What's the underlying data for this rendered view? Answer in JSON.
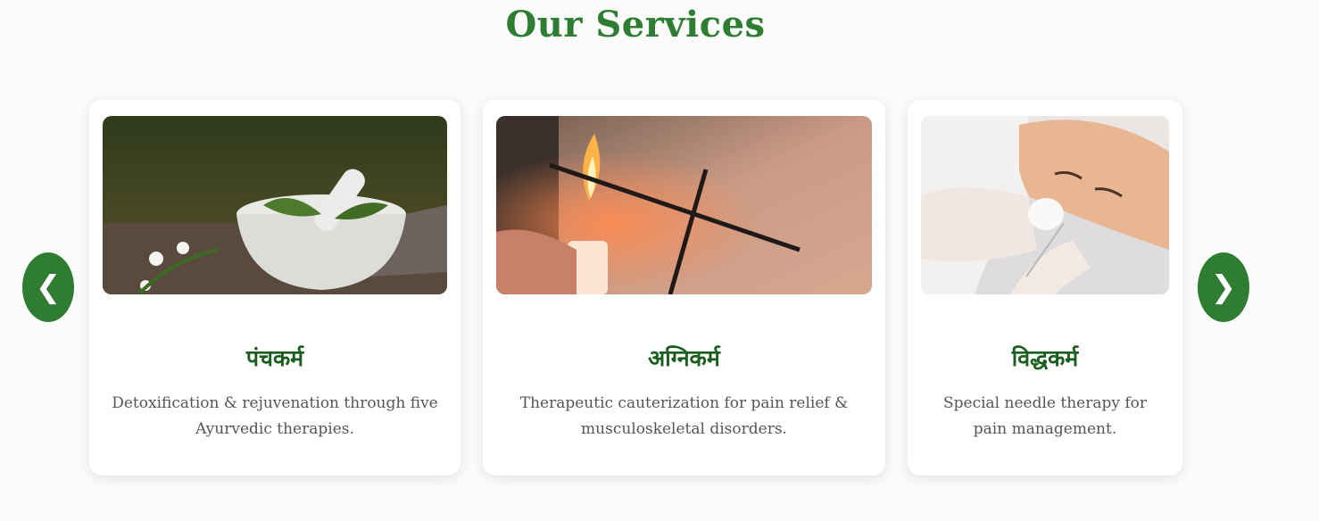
{
  "section": {
    "title": "Our Services"
  },
  "carousel": {
    "prev_icon": "❮",
    "next_icon": "❯"
  },
  "services": [
    {
      "title": "पंचकर्म",
      "description": "Detoxification & rejuvenation through five Ayurvedic therapies.",
      "image": "mortar-pestle-herbs-photo"
    },
    {
      "title": "अग्निकर्म",
      "description": "Therapeutic cauterization for pain relief & musculoskeletal disorders.",
      "image": "heated-rod-cauterization-photo"
    },
    {
      "title": "विद्धकर्म",
      "description": "Special needle therapy for pain management.",
      "image": "facial-needle-therapy-photo"
    }
  ],
  "colors": {
    "brand_green": "#2e7d32",
    "card_title_green": "#1b5e20",
    "text_gray": "#555555"
  }
}
